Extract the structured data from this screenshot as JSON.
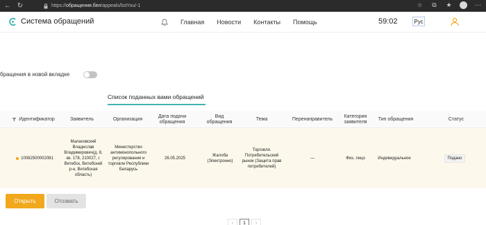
{
  "browser": {
    "url_prefix": "https://",
    "url_host": "обращения.бел",
    "url_path": "/appeals/listYou/-1"
  },
  "header": {
    "site_title": "Система обращений",
    "nav": [
      "Главная",
      "Новости",
      "Контакты",
      "Помощь"
    ],
    "timer": "59:02",
    "language": "Рус",
    "brand_color": "#3fb4b0",
    "accent_color": "#f2a81d"
  },
  "toggle": {
    "label": "бращения в новой вкладке",
    "enabled": false
  },
  "tab": {
    "label": "Список поданных вами обращений"
  },
  "table": {
    "columns": {
      "id": "Идентификатор",
      "applicant": "Заявитель",
      "organization": "Организация",
      "date": "Дата подачи обращения",
      "kind": "Вид обращения",
      "topic": "Тема",
      "redirector": "Перенаправитель",
      "category": "Категория заявителя",
      "type": "Тип обращения",
      "status": "Статус"
    },
    "rows": [
      {
        "id": "10082500002081",
        "applicant": "Малаховский Владислав Владимирович(д. 8, кв. 178, 210027, г. Витебск, Витебский р-н, Витебская область)",
        "organization": "Министерство антимонопольного регулирования и торговли Республики Беларусь",
        "date": "26.05.2025",
        "kind": "Жалоба (Электронно)",
        "topic": "Торговля. Потребительский рынок (Защита прав потребителей)",
        "redirector": "—",
        "category": "Физ. лицо",
        "type": "Индивидуальное",
        "status": "Подано"
      }
    ]
  },
  "actions": {
    "open": "Открыть",
    "withdraw": "Отозвать"
  },
  "pagination": {
    "prev": "‹",
    "current": "1",
    "next": "›"
  }
}
